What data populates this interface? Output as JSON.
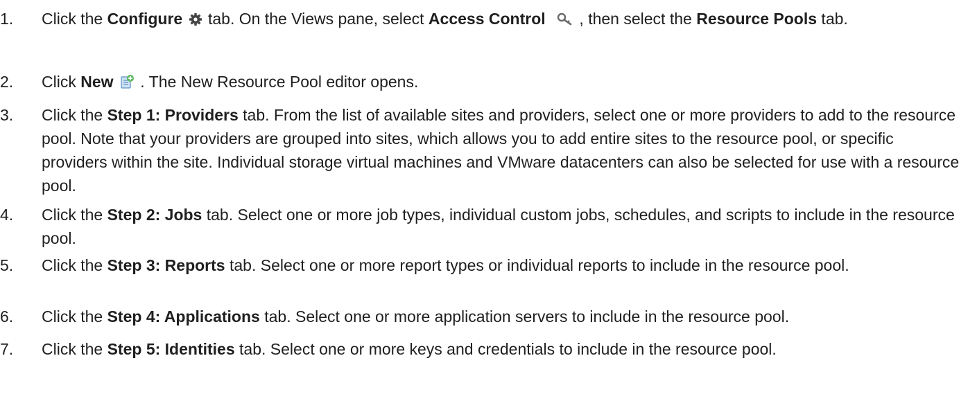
{
  "steps": [
    {
      "number": "1.",
      "pre1": "Click the ",
      "b1": "Configure",
      "icon1": "gear-icon",
      "post1": " tab. On the Views pane, select ",
      "b2": "Access Control",
      "icon2": "key-icon",
      "post2": " , then select the ",
      "b3": "Resource Pools",
      "post3": " tab."
    },
    {
      "number": "2.",
      "pre1": "Click ",
      "b1": "New",
      "icon1": "new-document-icon",
      "post1": " . The New Resource Pool editor opens."
    },
    {
      "number": "3.",
      "pre1": "Click the ",
      "b1": "Step 1: Providers",
      "post1": " tab. From the list of available sites and providers, select one or more providers to add to the resource pool. Note that your providers are grouped into sites, which allows you to add entire sites to the resource pool, or specific providers within the site. Individual storage virtual machines and VMware datacenters can also be selected for use with a resource pool."
    },
    {
      "number": "4.",
      "pre1": "Click the ",
      "b1": "Step 2: Jobs",
      "post1": " tab. Select one or more job types, individual custom jobs, schedules, and scripts to include in the resource pool."
    },
    {
      "number": "5.",
      "pre1": "Click the ",
      "b1": "Step 3: Reports",
      "post1": " tab. Select one or more report types or individual reports to include in the resource pool."
    },
    {
      "number": "6.",
      "pre1": "Click the ",
      "b1": "Step 4: Applications",
      "post1": " tab. Select one or more application servers to include in the resource pool."
    },
    {
      "number": "7.",
      "pre1": "Click the ",
      "b1": "Step 5: Identities",
      "post1": " tab. Select one or more keys and credentials to include in the resource pool."
    }
  ]
}
